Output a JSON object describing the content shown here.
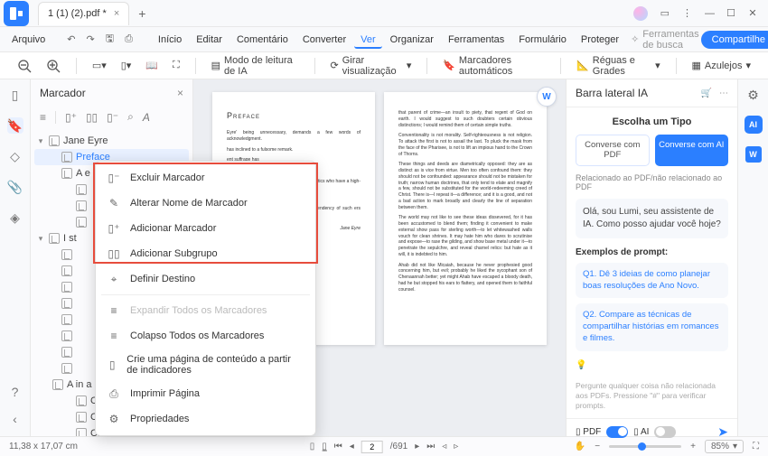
{
  "titlebar": {
    "file_title": "1 (1) (2).pdf *"
  },
  "menu": {
    "items": [
      "Arquivo",
      "Início",
      "Editar",
      "Comentário",
      "Converter",
      "Ver",
      "Organizar",
      "Ferramentas",
      "Formulário",
      "Proteger"
    ],
    "active_index": 5,
    "search_placeholder": "Ferramentas de busca",
    "share": "Compartilhe"
  },
  "toolbar": {
    "reading_mode": "Modo de leitura de IA",
    "rotate": "Girar visualização",
    "auto_bookmarks": "Marcadores automáticos",
    "rulers": "Réguas e Grades",
    "tiles": "Azulejos"
  },
  "bookmark": {
    "title": "Marcador",
    "tree": [
      {
        "label": "Jane Eyre",
        "level": 0,
        "chev": "▾"
      },
      {
        "label": "Preface",
        "level": 1,
        "sel": true
      },
      {
        "label": "A e",
        "level": 1
      },
      {
        "label": "",
        "level": 2
      },
      {
        "label": "",
        "level": 2
      },
      {
        "label": "",
        "level": 2
      },
      {
        "label": "I st",
        "level": 0,
        "chev": "▾"
      },
      {
        "label": "",
        "level": 1
      },
      {
        "label": "",
        "level": 1
      },
      {
        "label": "",
        "level": 1
      },
      {
        "label": "",
        "level": 1
      },
      {
        "label": "",
        "level": 1
      },
      {
        "label": "",
        "level": 1
      },
      {
        "label": "",
        "level": 1
      },
      {
        "label": "",
        "level": 1
      },
      {
        "label": "A in a play; and when I draw",
        "level": 1
      },
      {
        "label": "Chapter XII",
        "level": 2
      },
      {
        "label": "Chapter XIII",
        "level": 2
      },
      {
        "label": "Chapter XIV",
        "level": 2
      }
    ]
  },
  "context_menu": {
    "items_top": [
      "Excluir Marcador",
      "Alterar Nome de Marcador",
      "Adicionar Marcador",
      "Adicionar Subgrupo",
      "Definir Destino"
    ],
    "items_bottom": [
      "Expandir Todos os Marcadores",
      "Colapso Todos os Marcadores",
      "Crie uma página de conteúdo a partir de indicadores",
      "Imprimir Página",
      "Propriedades"
    ]
  },
  "doc": {
    "left_page": {
      "heading": "Preface",
      "paras": [
        "Eyre' being unnecessary, demands a few words of acknowledgment.",
        "has inclined to a fulsome remark.",
        "ent suffrage has",
        "aface, their energy, and have preferred an",
        "y personifications hel by my Publishers aid critics who have a high-minded mere things; to them, I",
        "e, I say cordially,",
        "class; a small one, overlooked. I mean a tendency of such ers against bigotry—"
      ],
      "sig": "Jane Eyre"
    },
    "right_page": {
      "paras": [
        "that parent of crime—an insult to piety, that regent of God on earth. I would suggest to such doubters certain obvious distinctions; I would remind them of certain simple truths.",
        "Conventionality is not morality. Self-righteousness is not religion. To attack the first is not to assail the last. To pluck the mask from the face of the Pharisee, is not to lift an impious hand to the Crown of Thorns.",
        "These things and deeds are diametrically opposed: they are as distinct as is vice from virtue. Men too often confound them: they should not be confounded: appearance should not be mistaken for truth; narrow human doctrines, that only tend to elate and magnify a few, should not be substituted for the world-redeeming creed of Christ. There is—I repeat it—a difference; and it is a good, and not a bad action to mark broadly and clearly the line of separation between them.",
        "The world may not like to see these ideas dissevered, for it has been accustomed to blend them; finding it convenient to make external show pass for sterling worth—to let whitewashed walls vouch for clean shrines. It may hate him who dares to scrutinise and expose—to rase the gilding, and show base metal under it—to penetrate the sepulchre, and reveal charnel relics: but hate as it will, it is indebted to him.",
        "Ahab did not like Micaiah, because he never prophesied good concerning him, but evil; probably he liked the sycophant son of Chenaannah better; yet might Ahab have escaped a bloody death, had he but stopped his ears to flattery, and opened them to faithful counsel."
      ]
    }
  },
  "ai": {
    "title": "Barra lateral IA",
    "subtitle": "Escolha um Tipo",
    "tab1": "Converse com PDF",
    "tab2": "Converse com AI",
    "related": "Relacionado ao PDF/não relacionado ao PDF",
    "greeting": "Olá, sou Lumi, seu assistente de IA. Como posso ajudar você hoje?",
    "examples_title": "Exemplos de prompt:",
    "example1": "Q1. Dê 3 ideias de como planejar boas resoluções de Ano Novo.",
    "example2": "Q2. Compare as técnicas de compartilhar histórias em romances e filmes.",
    "footer_note": "Pergunte qualquer coisa não relacionada aos PDFs. Pressione \"#\" para verificar prompts.",
    "pdf_label": "PDF",
    "ai_label": "AI"
  },
  "status": {
    "dims": "11,38 x 17,07 cm",
    "page_current": "2",
    "page_total": "/691",
    "zoom": "85%"
  }
}
